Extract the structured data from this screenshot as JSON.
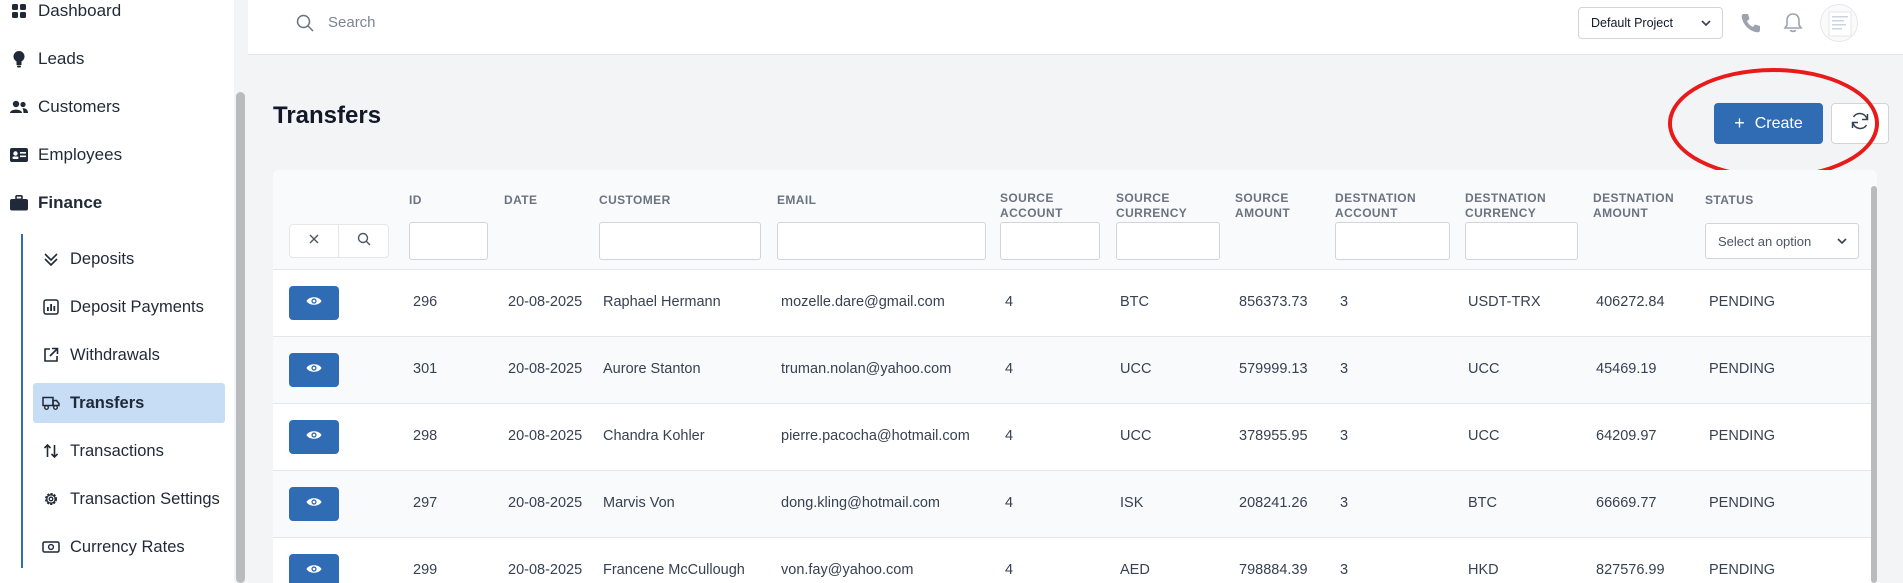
{
  "sidebar": {
    "items": [
      {
        "label": "Dashboard",
        "icon": "grid-icon"
      },
      {
        "label": "Leads",
        "icon": "lightbulb-icon"
      },
      {
        "label": "Customers",
        "icon": "users-icon"
      },
      {
        "label": "Employees",
        "icon": "id-card-icon"
      },
      {
        "label": "Finance",
        "icon": "briefcase-icon"
      }
    ],
    "finance_items": [
      {
        "label": "Deposits",
        "icon": "chevrons-down-icon"
      },
      {
        "label": "Deposit Payments",
        "icon": "chart-icon"
      },
      {
        "label": "Withdrawals",
        "icon": "external-link-icon"
      },
      {
        "label": "Transfers",
        "icon": "truck-icon",
        "active": true
      },
      {
        "label": "Transactions",
        "icon": "arrows-updown-icon"
      },
      {
        "label": "Transaction Settings",
        "icon": "gear-icon"
      },
      {
        "label": "Currency Rates",
        "icon": "money-icon"
      }
    ]
  },
  "topbar": {
    "search_placeholder": "Search",
    "project": "Default Project"
  },
  "page": {
    "title": "Transfers",
    "create_label": "Create",
    "accent": "#2f6cb3",
    "highlight_color": "#e81b1b"
  },
  "table": {
    "columns": [
      {
        "line1": "ID",
        "line2": ""
      },
      {
        "line1": "DATE",
        "line2": ""
      },
      {
        "line1": "CUSTOMER",
        "line2": ""
      },
      {
        "line1": "EMAIL",
        "line2": ""
      },
      {
        "line1": "SOURCE",
        "line2": "ACCOUNT"
      },
      {
        "line1": "SOURCE",
        "line2": "CURRENCY"
      },
      {
        "line1": "SOURCE",
        "line2": "AMOUNT"
      },
      {
        "line1": "DESTNATION",
        "line2": "ACCOUNT"
      },
      {
        "line1": "DESTNATION",
        "line2": "CURRENCY"
      },
      {
        "line1": "DESTNATION",
        "line2": "AMOUNT"
      },
      {
        "line1": "STATUS",
        "line2": ""
      }
    ],
    "status_placeholder": "Select an option",
    "rows": [
      {
        "id": "296",
        "date": "20-08-2025",
        "customer": "Raphael Hermann",
        "email": "mozelle.dare@gmail.com",
        "src_account": "4",
        "src_currency": "BTC",
        "src_amount": "856373.73",
        "dst_account": "3",
        "dst_currency": "USDT-TRX",
        "dst_amount": "406272.84",
        "status": "PENDING"
      },
      {
        "id": "301",
        "date": "20-08-2025",
        "customer": "Aurore Stanton",
        "email": "truman.nolan@yahoo.com",
        "src_account": "4",
        "src_currency": "UCC",
        "src_amount": "579999.13",
        "dst_account": "3",
        "dst_currency": "UCC",
        "dst_amount": "45469.19",
        "status": "PENDING"
      },
      {
        "id": "298",
        "date": "20-08-2025",
        "customer": "Chandra Kohler",
        "email": "pierre.pacocha@hotmail.com",
        "src_account": "4",
        "src_currency": "UCC",
        "src_amount": "378955.95",
        "dst_account": "3",
        "dst_currency": "UCC",
        "dst_amount": "64209.97",
        "status": "PENDING"
      },
      {
        "id": "297",
        "date": "20-08-2025",
        "customer": "Marvis Von",
        "email": "dong.kling@hotmail.com",
        "src_account": "4",
        "src_currency": "ISK",
        "src_amount": "208241.26",
        "dst_account": "3",
        "dst_currency": "BTC",
        "dst_amount": "66669.77",
        "status": "PENDING"
      },
      {
        "id": "299",
        "date": "20-08-2025",
        "customer": "Francene McCullough",
        "email": "von.fay@yahoo.com",
        "src_account": "4",
        "src_currency": "AED",
        "src_amount": "798884.39",
        "dst_account": "3",
        "dst_currency": "HKD",
        "dst_amount": "827576.99",
        "status": "PENDING"
      }
    ]
  }
}
